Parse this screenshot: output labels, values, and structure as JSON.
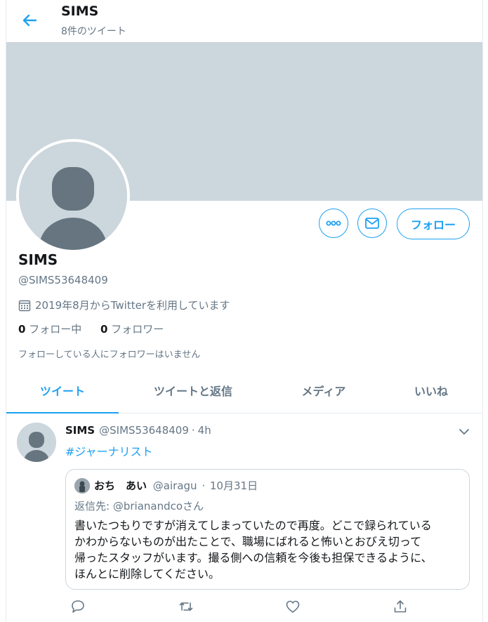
{
  "header": {
    "title": "SIMS",
    "subtitle": "8件のツイート"
  },
  "profile": {
    "name": "SIMS",
    "handle": "@SIMS53648409",
    "joined": "2019年8月からTwitterを利用しています",
    "following_count": "0",
    "following_label": "フォロー中",
    "followers_count": "0",
    "followers_label": "フォロワー",
    "followers_note": "フォローしている人にフォロワーはいません",
    "follow_button": "フォロー"
  },
  "tabs": [
    {
      "label": "ツイート",
      "active": true
    },
    {
      "label": "ツイートと返信",
      "active": false
    },
    {
      "label": "メディア",
      "active": false
    },
    {
      "label": "いいね",
      "active": false
    }
  ],
  "tweet": {
    "name": "SIMS",
    "handle": "@SIMS53648409",
    "separator": "·",
    "time": "4h",
    "hashtag": "#ジャーナリスト",
    "quote": {
      "name": "おち　あい",
      "handle": "@airagu",
      "separator": "·",
      "date": "10月31日",
      "reply_prefix": "返信先:",
      "reply_mention": "@brianandcoさん",
      "body_lines": [
        "書いたつもりですが消えてしまっていたので再度。どこで録られている",
        "かわからないものが出たことで、職場にばれると怖いとおびえ切って",
        "帰ったスタッフがいます。撮る側への信頼を今後も担保できるように、",
        "ほんとに削除してください。"
      ]
    }
  },
  "colors": {
    "accent": "#1da1f2",
    "banner": "#ccd6dd",
    "secondary_text": "#657786"
  },
  "icons": {
    "back": "arrow-left-icon",
    "more": "more-dots-icon",
    "message": "envelope-icon",
    "calendar": "calendar-icon",
    "reply": "reply-icon",
    "retweet": "retweet-icon",
    "like": "heart-icon",
    "share": "share-icon"
  }
}
